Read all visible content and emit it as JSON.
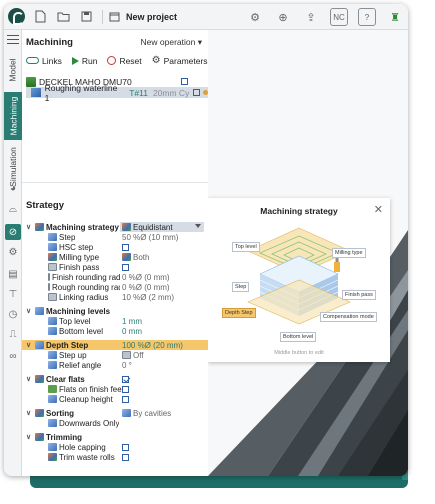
{
  "titlebar": {
    "project": "New project",
    "right_icons": [
      "gear-settings-icon",
      "zoom-icon",
      "nc-upload-icon",
      "nc-file-icon",
      "help-file-icon",
      "machine-icon"
    ]
  },
  "sidebar": {
    "tabs": [
      "Model",
      "Machining",
      "Simulation"
    ],
    "active_tab": "Machining"
  },
  "machining": {
    "title": "Machining",
    "new_operation": "New operation",
    "actions": {
      "links": "Links",
      "run": "Run",
      "reset": "Reset",
      "parameters": "Parameters"
    },
    "machine": "DECKEL MAHO DMU70",
    "operation": {
      "name": "Roughing waterline 1",
      "tool": "T#11",
      "desc": "20mm Cylind"
    }
  },
  "strategy": {
    "title": "Strategy",
    "rows": [
      {
        "name": "Machining strategy",
        "value": "Equidistant"
      },
      {
        "name": "Step",
        "value": "50 %Ø (10 mm)"
      },
      {
        "name": "HSC step",
        "value": ""
      },
      {
        "name": "Milling type",
        "value": "Both"
      },
      {
        "name": "Finish pass",
        "value": ""
      },
      {
        "name": "Finish rounding radius",
        "value": "0 %Ø (0 mm)"
      },
      {
        "name": "Rough rounding radius",
        "value": "0 %Ø (0 mm)"
      },
      {
        "name": "Linking radius",
        "value": "10 %Ø (2 mm)"
      },
      {
        "name": "Machining levels",
        "value": ""
      },
      {
        "name": "Top level",
        "value": "1 mm"
      },
      {
        "name": "Bottom level",
        "value": "0 mm"
      },
      {
        "name": "Depth Step",
        "value": "100 %Ø (20 mm)"
      },
      {
        "name": "Step up",
        "value": "Off"
      },
      {
        "name": "Relief angle",
        "value": "0 °"
      },
      {
        "name": "Clear flats",
        "value": ""
      },
      {
        "name": "Flats on finish feed",
        "value": ""
      },
      {
        "name": "Cleanup height",
        "value": ""
      },
      {
        "name": "Sorting",
        "value": "By cavities"
      },
      {
        "name": "Downwards Only",
        "value": ""
      },
      {
        "name": "Trimming",
        "value": ""
      },
      {
        "name": "Hole capping",
        "value": ""
      },
      {
        "name": "Trim waste rolls",
        "value": ""
      }
    ]
  },
  "popup": {
    "title": "Machining strategy",
    "labels": {
      "top_level": "Top level",
      "milling_type": "Milling type",
      "step": "Step",
      "finish_pass": "Finish pass",
      "depth_step": "Depth Step",
      "compensation_mode": "Compensation mode",
      "bottom_level": "Bottom level"
    },
    "footer": "Middle button to edit"
  },
  "colors": {
    "accent": "#2a7d73",
    "highlight": "#f5c66a",
    "selection": "#d6dce6",
    "brand_dark": "#1c4f46"
  }
}
